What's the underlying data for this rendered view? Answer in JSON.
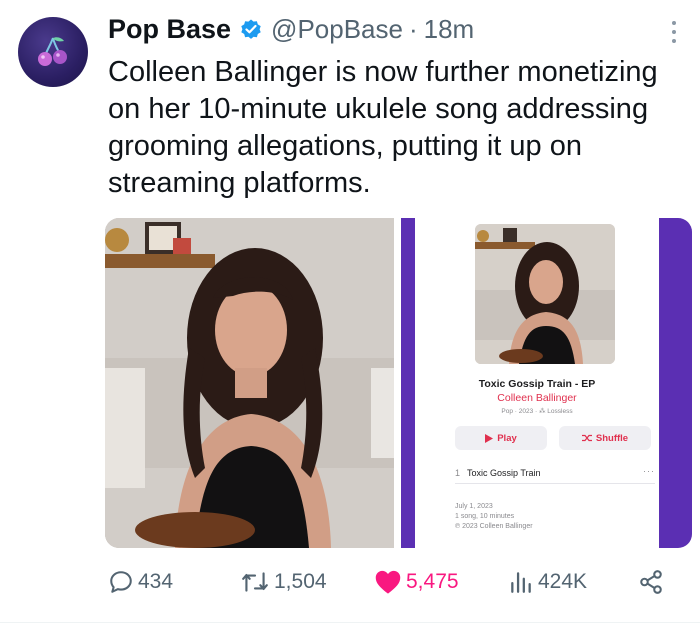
{
  "author": {
    "display_name": "Pop Base",
    "handle": "@PopBase",
    "separator": "·",
    "time": "18m",
    "avatar_icon": "cherries-icon",
    "verified_color": "#1d9bf0"
  },
  "tweet": {
    "text": "Colleen Ballinger is now further monetizing on her 10-minute ukulele song addressing grooming allegations, putting it up on streaming platforms."
  },
  "album_card": {
    "title": "Toxic Gossip Train - EP",
    "artist": "Colleen Ballinger",
    "meta": "Pop · 2023 · ⁂ Lossless",
    "play_label": "Play",
    "shuffle_label": "Shuffle",
    "track_number": "1",
    "track_title": "Toxic Gossip Train",
    "track_more": "···",
    "release_date": "July 1, 2023",
    "duration": "1 song, 10 minutes",
    "copyright": "℗ 2023 Colleen Ballinger",
    "accent_color": "#e0304e"
  },
  "actions": {
    "replies": "434",
    "retweets": "1,504",
    "likes": "5,475",
    "views": "424K",
    "like_color": "#f91880"
  }
}
